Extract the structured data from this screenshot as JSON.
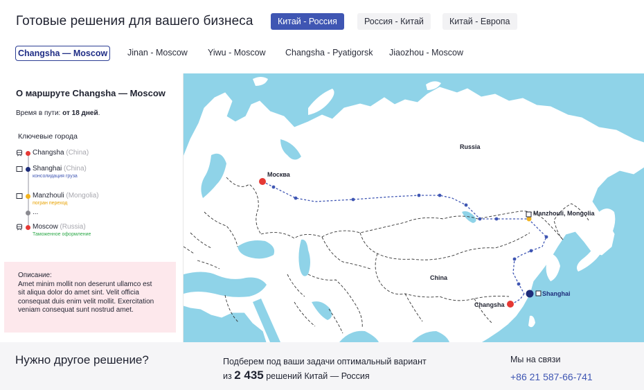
{
  "header": {
    "title": "Готовые решения для вашего бизнеса",
    "direction_tabs": [
      {
        "label": "Китай - Россия",
        "active": true
      },
      {
        "label": "Россия - Китай",
        "active": false
      },
      {
        "label": "Китай - Европа",
        "active": false
      }
    ]
  },
  "route_tabs": [
    {
      "label": "Changsha — Moscow",
      "active": true
    },
    {
      "label": "Jinan - Moscow",
      "active": false
    },
    {
      "label": "Yiwu - Moscow",
      "active": false
    },
    {
      "label": "Changsha - Pyatigorsk",
      "active": false
    },
    {
      "label": "Jiaozhou - Moscow",
      "active": false
    }
  ],
  "route_info": {
    "heading": "О маршруте Changsha — Moscow",
    "time_label": "Время в пути:",
    "time_value": "от 18 дней",
    "cities_heading": "Ключевые города",
    "cities": [
      {
        "name": "Changsha",
        "country": "(China)",
        "note": "",
        "dot_color": "#e53935",
        "note_color": "",
        "icon": "train-icon"
      },
      {
        "name": "Shanghai",
        "country": "(China)",
        "note": "консолидация груза",
        "dot_color": "#1e2d7a",
        "note_color": "#3f56b3",
        "icon": "square-icon"
      },
      {
        "name": "Manzhouli",
        "country": "(Mongolia)",
        "note": "погран переход",
        "dot_color": "#f2b31f",
        "note_color": "#e8a200",
        "icon": "square-icon"
      },
      {
        "name": "...",
        "country": "",
        "note": "",
        "dot_color": "#8a8a90",
        "note_color": "",
        "icon": ""
      },
      {
        "name": "Moscow",
        "country": "(Russia)",
        "note": "Таможенное оформление",
        "dot_color": "#e53935",
        "note_color": "#2eaa4a",
        "icon": "train-icon"
      }
    ],
    "description_label": "Описание:",
    "description_text": "Amet minim mollit non deserunt ullamco est sit aliqua dolor do amet sint. Velit officia consequat duis enim velit mollit. Exercitation veniam consequat sunt nostrud amet."
  },
  "map": {
    "labels": {
      "russia": "Russia",
      "china": "China",
      "moscow": "Москва",
      "manzhouli": "Manzhouli, Mongolia",
      "changsha": "Changsha",
      "shanghai": "Shanghai"
    },
    "route_color": "#3f56b3",
    "land_color": "#ffffff",
    "water_color": "#8fd3e8"
  },
  "footer": {
    "title": "Нужно другое решение?",
    "offer_line1": "Подберем под ваши задачи оптимальный вариант",
    "offer_prefix": "из",
    "offer_count": "2 435",
    "offer_suffix": "решений Китай — Россия",
    "contact_label": "Мы на связи",
    "phone": "+86 21 587-66-741"
  }
}
